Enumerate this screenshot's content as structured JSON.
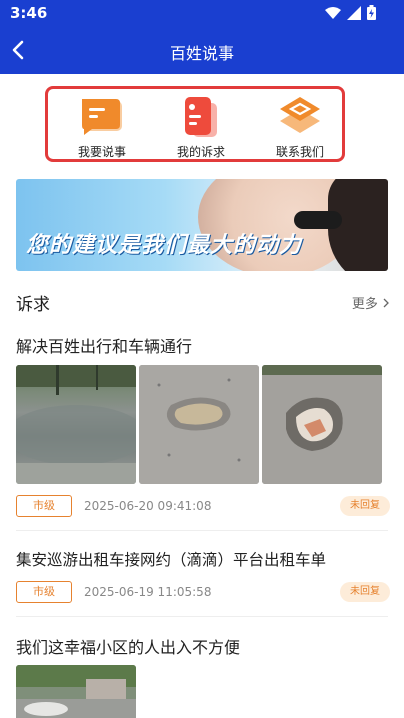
{
  "status_bar": {
    "time": "3:46"
  },
  "header": {
    "title": "百姓说事"
  },
  "actions": [
    {
      "label": "我要说事",
      "icon": "chat-bubble-icon"
    },
    {
      "label": "我的诉求",
      "icon": "document-icon"
    },
    {
      "label": "联系我们",
      "icon": "layers-icon"
    }
  ],
  "banner": {
    "slogan": "您的建议是我们最大的动力"
  },
  "section": {
    "title": "诉求",
    "more": "更多"
  },
  "items": [
    {
      "title": "解决百姓出行和车辆通行",
      "level": "市级",
      "date": "2025-06-20 09:41:08",
      "status": "未回复"
    },
    {
      "title": "集安巡游出租车接网约（滴滴）平台出租车单",
      "level": "市级",
      "date": "2025-06-19 11:05:58",
      "status": "未回复"
    },
    {
      "title": "我们这幸福小区的人出入不方便"
    }
  ],
  "colors": {
    "primary": "#1a3fd0",
    "accent": "#e6822f",
    "highlight_border": "#e23b3b"
  }
}
